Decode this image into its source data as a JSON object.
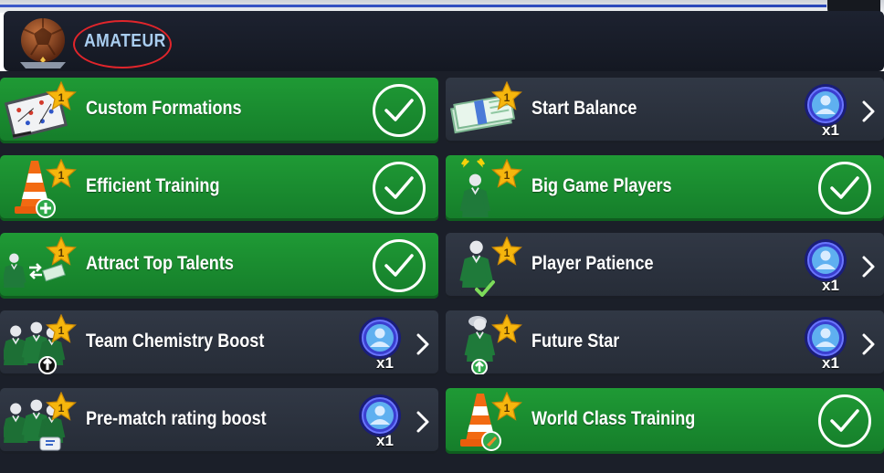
{
  "header": {
    "tier": "AMATEUR"
  },
  "colors": {
    "unlocked": "#1a8c30",
    "locked": "#2c323e",
    "annotation": "#e0252b",
    "tier_text": "#a9cdef",
    "star": "#f6b60d"
  },
  "cards": [
    {
      "label": "Custom Formations",
      "rank": "1",
      "state": "unlocked",
      "icon": "tactics-board-icon"
    },
    {
      "label": "Start Balance",
      "rank": "1",
      "state": "locked",
      "icon": "cash-stack-icon",
      "cost_qty": "x1"
    },
    {
      "label": "Efficient Training",
      "rank": "1",
      "state": "unlocked",
      "icon": "training-cone-icon"
    },
    {
      "label": "Big Game Players",
      "rank": "1",
      "state": "unlocked",
      "icon": "energized-player-icon"
    },
    {
      "label": "Attract Top Talents",
      "rank": "1",
      "state": "unlocked",
      "icon": "player-transfer-icon"
    },
    {
      "label": "Player Patience",
      "rank": "1",
      "state": "locked",
      "icon": "patient-player-icon",
      "cost_qty": "x1"
    },
    {
      "label": "Team Chemistry Boost",
      "rank": "1",
      "state": "locked",
      "icon": "team-players-icon",
      "cost_qty": "x1"
    },
    {
      "label": "Future Star",
      "rank": "1",
      "state": "locked",
      "icon": "young-player-icon",
      "cost_qty": "x1"
    },
    {
      "label": "Pre-match rating boost",
      "rank": "1",
      "state": "locked",
      "icon": "squad-rating-icon",
      "cost_qty": "x1"
    },
    {
      "label": "World Class Training",
      "rank": "1",
      "state": "unlocked",
      "icon": "training-cone-boot-icon"
    }
  ]
}
